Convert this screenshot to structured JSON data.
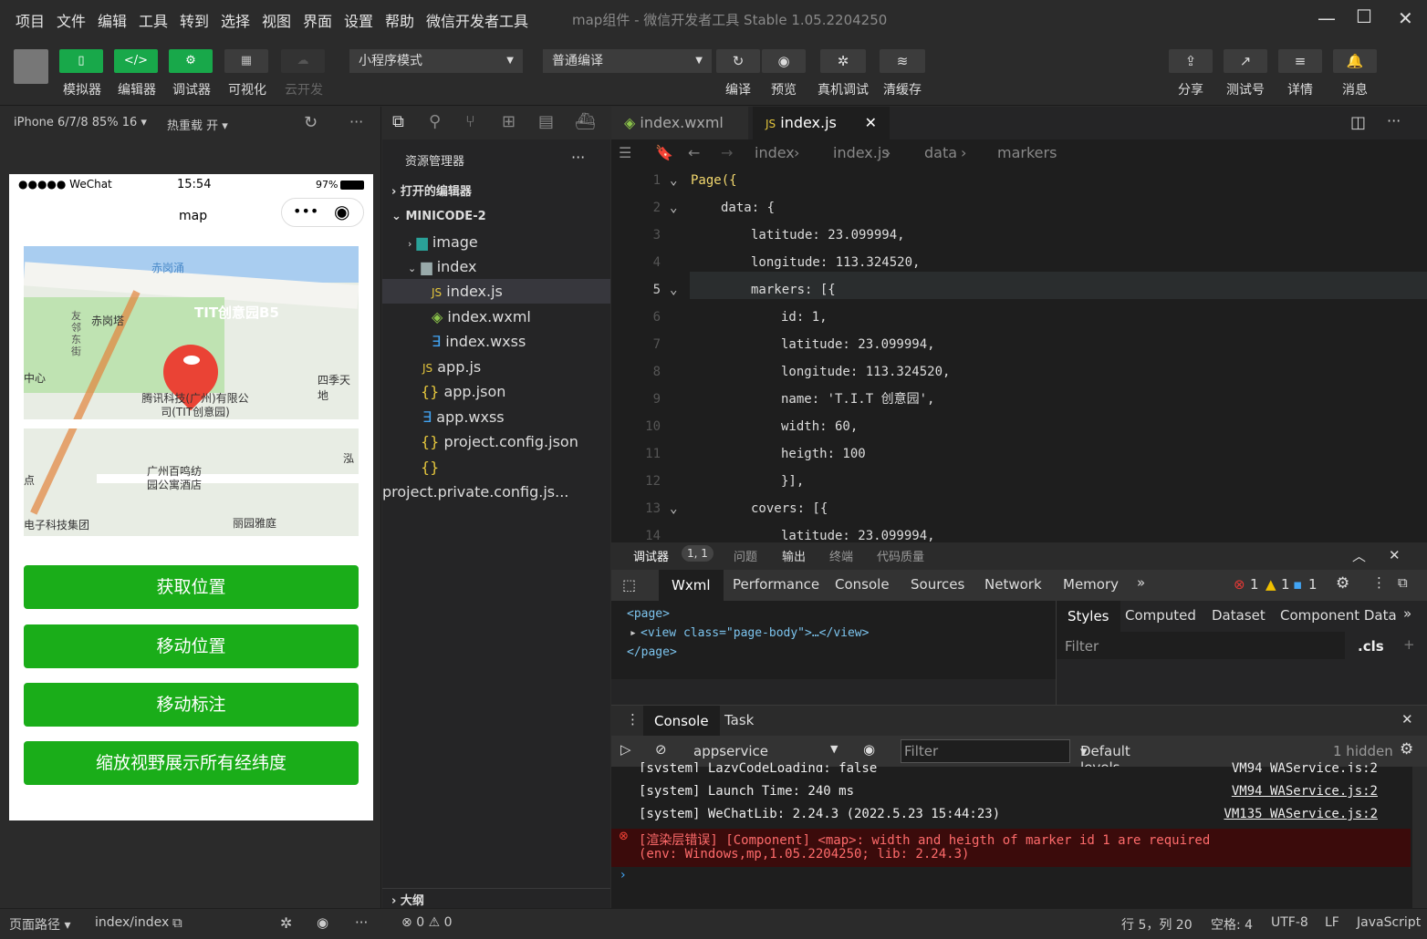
{
  "menu": [
    "项目",
    "文件",
    "编辑",
    "工具",
    "转到",
    "选择",
    "视图",
    "界面",
    "设置",
    "帮助",
    "微信开发者工具"
  ],
  "window_title": "map组件 - 微信开发者工具 Stable 1.05.2204250",
  "toolbar": {
    "simulator": "模拟器",
    "editor": "编辑器",
    "debugger": "调试器",
    "visual": "可视化",
    "cloud": "云开发",
    "mode": "小程序模式",
    "compile_mode": "普通编译",
    "compile": "编译",
    "preview": "预览",
    "real_debug": "真机调试",
    "clear_cache": "清缓存",
    "share": "分享",
    "test_id": "测试号",
    "details": "详情",
    "messages": "消息"
  },
  "sim_bar": {
    "device": "iPhone 6/7/8 85% 16",
    "hot_reload": "热重载 开"
  },
  "phone": {
    "status_left": "●●●●● WeChat",
    "time": "15:54",
    "battery": "97%",
    "title": "map",
    "map_labels": [
      "赤岗涌",
      "TIT创意园B5",
      "赤岗塔",
      "友邻东街",
      "中心",
      "四季天地",
      "腾讯科技(广州)有限公司(TIT创意园)",
      "广州百鸣纺园公寓酒店",
      "泓",
      "丽园雅庭",
      "电子科技集团",
      "点"
    ],
    "buttons": [
      "获取位置",
      "移动位置",
      "移动标注",
      "缩放视野展示所有经纬度"
    ]
  },
  "explorer": {
    "title": "资源管理器",
    "open_editors": "打开的编辑器",
    "project": "MINICODE-2",
    "items": [
      "image",
      "index",
      "index.js",
      "index.wxml",
      "index.wxss",
      "app.js",
      "app.json",
      "app.wxss",
      "project.config.json",
      "project.private.config.js..."
    ],
    "outline": "大纲"
  },
  "editor": {
    "tabs": [
      "index.wxml",
      "index.js"
    ],
    "breadcrumb": [
      "index",
      "index.js",
      "data",
      "markers"
    ],
    "lines": [
      {
        "n": "1",
        "t": "Page({"
      },
      {
        "n": "2",
        "t": "data: {"
      },
      {
        "n": "3",
        "t": "latitude: 23.099994,"
      },
      {
        "n": "4",
        "t": "longitude: 113.324520,"
      },
      {
        "n": "5",
        "t": "markers: [{"
      },
      {
        "n": "6",
        "t": "id: 1,"
      },
      {
        "n": "7",
        "t": "latitude: 23.099994,"
      },
      {
        "n": "8",
        "t": "longitude: 113.324520,"
      },
      {
        "n": "9",
        "t": "name: 'T.I.T 创意园',"
      },
      {
        "n": "10",
        "t": "width: 60,"
      },
      {
        "n": "11",
        "t": "heigth: 100"
      },
      {
        "n": "12",
        "t": "}],"
      },
      {
        "n": "13",
        "t": "covers: [{"
      },
      {
        "n": "14",
        "t": "latitude: 23.099994,"
      }
    ]
  },
  "debug": {
    "tabs": [
      "调试器",
      "1, 1",
      "问题",
      "输出",
      "终端",
      "代码质量"
    ],
    "devtabs": [
      "Wxml",
      "Performance",
      "Console",
      "Sources",
      "Network",
      "Memory"
    ],
    "err_count": "1",
    "warn_count": "1",
    "info_count": "1",
    "wxml": [
      "<page>",
      "<view class=\"page-body\">…</view>",
      "</page>"
    ],
    "style_tabs": [
      "Styles",
      "Computed",
      "Dataset",
      "Component Data"
    ],
    "filter": "Filter",
    "cls": ".cls",
    "console_tabs": [
      "Console",
      "Task"
    ],
    "context": "appservice",
    "levels": "Default levels",
    "hidden": "1 hidden",
    "logs": [
      {
        "t": "[system] LazyCodeLoading: false",
        "src": "VM94 WAService.js:2"
      },
      {
        "t": "[system] Launch Time: 240 ms",
        "src": "VM94 WAService.js:2"
      },
      {
        "t": "[system] WeChatLib: 2.24.3 (2022.5.23 15:44:23)",
        "src": "VM135 WAService.js:2"
      }
    ],
    "error1": "[渲染层错误] [Component] <map>: width and heigth of marker id 1 are required",
    "error2": "(env: Windows,mp,1.05.2204250; lib: 2.24.3)"
  },
  "status": {
    "path_label": "页面路径",
    "path": "index/index",
    "errors": "0",
    "warnings": "0",
    "pos": "行 5，列 20",
    "spaces": "空格: 4",
    "encoding": "UTF-8",
    "eol": "LF",
    "lang": "JavaScript"
  },
  "colors": {
    "green": "#1aad19",
    "toolbar_green": "#18a84a",
    "error_bg": "#3b0b0b"
  }
}
